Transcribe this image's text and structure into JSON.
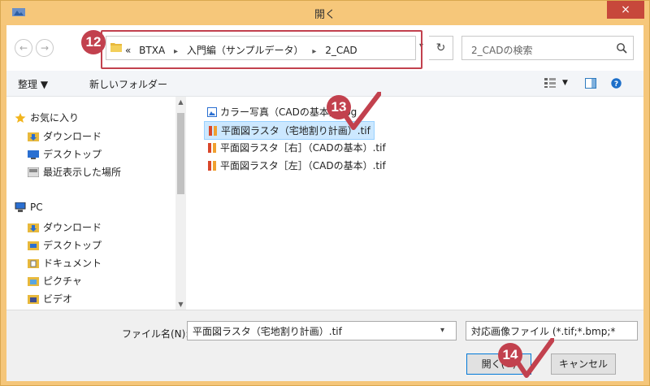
{
  "window": {
    "title": "開く",
    "close_glyph": "×"
  },
  "nav": {
    "back_glyph": "←",
    "forward_glyph": "→"
  },
  "address": {
    "prefix": "«",
    "crumbs": [
      "BTXA",
      "入門編（サンプルデータ）",
      "2_CAD"
    ],
    "separator": "▸",
    "dropdown_glyph": "▾",
    "refresh_glyph": "↻"
  },
  "search": {
    "placeholder": "2_CADの検索"
  },
  "toolbar": {
    "organize": "整理 ▼",
    "new_folder": "新しいフォルダー",
    "view_drop": "▼"
  },
  "sidebar": {
    "favorites": "お気に入り",
    "fav_items": [
      "ダウンロード",
      "デスクトップ",
      "最近表示した場所"
    ],
    "pc": "PC",
    "pc_items": [
      "ダウンロード",
      "デスクトップ",
      "ドキュメント",
      "ピクチャ",
      "ビデオ"
    ]
  },
  "files": [
    {
      "name": "カラー写真（CADの基本）.jpg",
      "type": "jpg"
    },
    {
      "name": "平面図ラスタ（宅地割り計画）.tif",
      "type": "tif",
      "selected": true
    },
    {
      "name": "平面図ラスタ［右］（CADの基本）.tif",
      "type": "tif"
    },
    {
      "name": "平面図ラスタ［左］（CADの基本）.tif",
      "type": "tif"
    }
  ],
  "footer": {
    "filename_label": "ファイル名(N):",
    "filename_value": "平面図ラスタ（宅地割り計画）.tif",
    "type_value": "対応画像ファイル (*.tif;*.bmp;*",
    "open_button": "開く(O)",
    "cancel_button": "キャンセル",
    "dropdown_glyph": "▾"
  },
  "annotations": {
    "step12": "12",
    "step13": "13",
    "step14": "14"
  },
  "colors": {
    "accent": "#c2414e",
    "selection": "#cce8ff",
    "titlebar": "#f6c77a",
    "close": "#c7483b"
  }
}
